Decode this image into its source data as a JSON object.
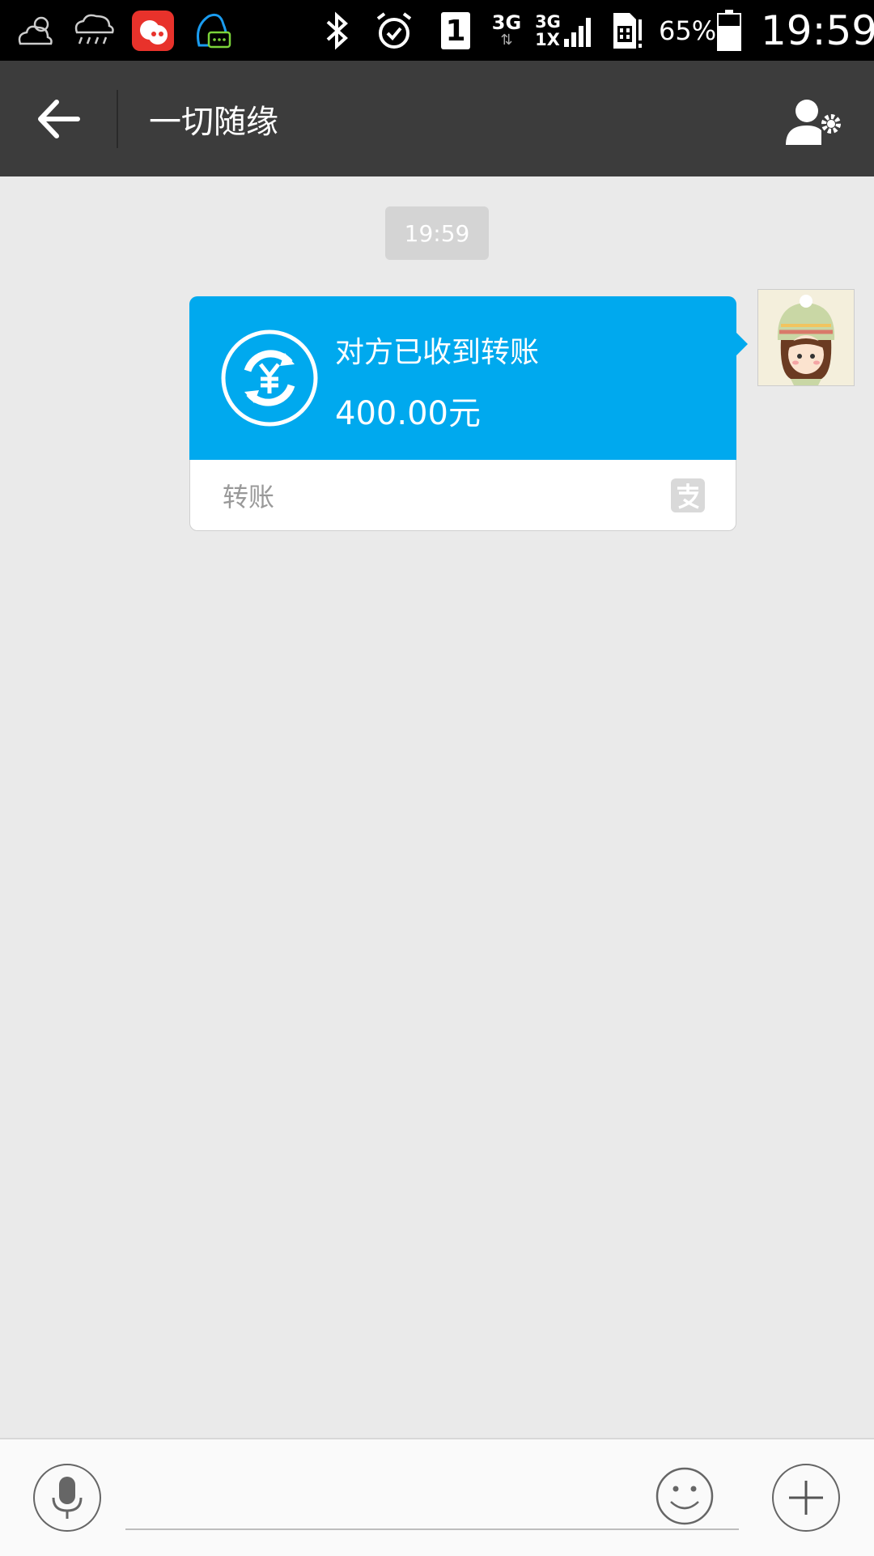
{
  "status_bar": {
    "icons": [
      "weather-cloudy-icon",
      "weather-rain-icon",
      "weibo-app-icon",
      "qq-app-icon",
      "bluetooth-icon",
      "alarm-icon",
      "sim1-icon",
      "signal-3g-icon",
      "signal-3g-1x-icon",
      "sim-card-alert-icon",
      "battery-icon"
    ],
    "network_1": "3G",
    "network_2_top": "3G",
    "network_2_bottom": "1X",
    "sim_slot": "1",
    "battery_percent": "65%",
    "time": "19:59"
  },
  "header": {
    "title": "一切随缘",
    "back_icon": "back-arrow-icon",
    "profile_settings_icon": "contact-settings-icon"
  },
  "chat": {
    "timestamp": "19:59",
    "message": {
      "title": "对方已收到转账",
      "amount": "400.00元",
      "type_label": "转账",
      "accent_color": "#00a9ee",
      "icon": "transfer-yuan-icon",
      "brand_icon": "alipay-icon"
    },
    "avatar": "user-avatar"
  },
  "input_bar": {
    "voice_icon": "microphone-icon",
    "emoji_icon": "smiley-icon",
    "plus_icon": "plus-icon",
    "text_value": ""
  }
}
